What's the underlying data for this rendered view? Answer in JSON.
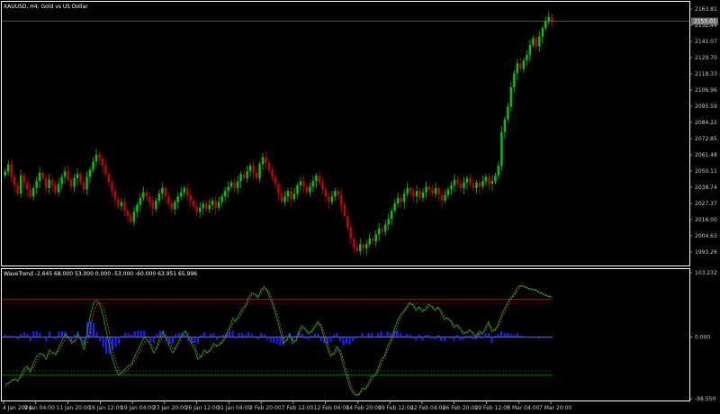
{
  "symbol_header": "XAUUSD, H4:  Gold vs US Dollar",
  "indicator_header": "WaveTrend -2.645 68.000 53.000 0.000 -53.000 -60.000 63.951 65.996",
  "current_price": "2155.01",
  "colors": {
    "background": "#000000",
    "bull_candle": "#00c800",
    "bear_candle": "#c80000",
    "axis": "#ffffff",
    "price_line": "#808080",
    "upper_band": "#c80000",
    "lower_band": "#00a000",
    "zero_line": "#a0a0ff",
    "histogram": "#2020ff",
    "wt1_line": "#00c000",
    "wt2_line": "#ff4040"
  },
  "price_axis": {
    "ticks": [
      "2163.81",
      "2152.44",
      "2141.07",
      "2129.70",
      "2118.33",
      "2106.96",
      "2095.59",
      "2084.22",
      "2072.85",
      "2061.48",
      "2050.11",
      "2038.74",
      "2027.37",
      "2016.00",
      "2004.63",
      "1993.26"
    ]
  },
  "indicator_axis": {
    "ticks": [
      "103.232",
      "0.000",
      "-98.550"
    ]
  },
  "time_axis": {
    "labels": [
      "4 Jan 2024",
      "9 Jan 04:00",
      "11 Jan 20:00",
      "16 Jan 12:00",
      "19 Jan 04:00",
      "23 Jan 20:00",
      "26 Jan 12:00",
      "31 Jan 04:00",
      "2 Feb 20:00",
      "7 Feb 12:00",
      "12 Feb 04:00",
      "14 Feb 20:00",
      "19 Feb 12:00",
      "22 Feb 04:00",
      "26 Feb 20:00",
      "29 Feb 12:00",
      "5 Mar 04:00",
      "7 Mar 20:00"
    ]
  },
  "chart_data": {
    "type": "candlestick",
    "price_range": [
      1984.0,
      2165.0
    ],
    "closes": [
      2048,
      2053,
      2044,
      2038,
      2032,
      2045,
      2040,
      2035,
      2030,
      2036,
      2041,
      2047,
      2043,
      2036,
      2042,
      2038,
      2033,
      2039,
      2044,
      2048,
      2042,
      2037,
      2043,
      2046,
      2040,
      2035,
      2044,
      2049,
      2055,
      2060,
      2057,
      2052,
      2046,
      2040,
      2034,
      2028,
      2023,
      2026,
      2020,
      2016,
      2012,
      2019,
      2024,
      2029,
      2033,
      2030,
      2026,
      2021,
      2027,
      2032,
      2036,
      2030,
      2025,
      2021,
      2026,
      2030,
      2033,
      2036,
      2031,
      2027,
      2023,
      2019,
      2022,
      2025,
      2021,
      2024,
      2027,
      2022,
      2026,
      2030,
      2034,
      2037,
      2040,
      2036,
      2041,
      2046,
      2043,
      2048,
      2052,
      2047,
      2043,
      2053,
      2058,
      2054,
      2049,
      2044,
      2039,
      2032,
      2026,
      2030,
      2034,
      2028,
      2032,
      2038,
      2041,
      2037,
      2033,
      2037,
      2041,
      2045,
      2040,
      2035,
      2030,
      2026,
      2030,
      2034,
      2031,
      2024,
      2016,
      2008,
      2000,
      1994,
      1991,
      1996,
      1993,
      1996,
      2000,
      1998,
      2003,
      2007,
      2005,
      2010,
      2014,
      2020,
      2025,
      2029,
      2026,
      2032,
      2036,
      2033,
      2030,
      2034,
      2029,
      2033,
      2037,
      2035,
      2032,
      2036,
      2031,
      2027,
      2031,
      2035,
      2038,
      2042,
      2039,
      2036,
      2040,
      2043,
      2039,
      2036,
      2040,
      2037,
      2041,
      2044,
      2039,
      2041,
      2045,
      2052,
      2076,
      2085,
      2094,
      2108,
      2118,
      2125,
      2121,
      2127,
      2131,
      2138,
      2143,
      2137,
      2144,
      2150,
      2155,
      2158,
      2155
    ],
    "wavetrend": {
      "upper_level": 53,
      "upper_level_2": 60,
      "lower_level": -53,
      "lower_level_2": -60,
      "range": [
        -98.55,
        103.232
      ],
      "wt1": [
        -75,
        -72,
        -68,
        -66,
        -70,
        -60,
        -50,
        -46,
        -55,
        -40,
        -30,
        -25,
        -28,
        -35,
        -20,
        -25,
        -28,
        -15,
        -5,
        5,
        0,
        -10,
        -5,
        5,
        -5,
        -20,
        10,
        35,
        55,
        58,
        50,
        35,
        10,
        -15,
        -35,
        -50,
        -60,
        -55,
        -50,
        -45,
        -42,
        -30,
        -20,
        -10,
        0,
        -5,
        -12,
        -25,
        -15,
        0,
        10,
        -2,
        -15,
        -25,
        -15,
        -5,
        5,
        10,
        0,
        -10,
        -20,
        -35,
        -30,
        -20,
        -25,
        -18,
        -10,
        -15,
        -10,
        -5,
        5,
        15,
        30,
        25,
        35,
        45,
        50,
        62,
        70,
        68,
        62,
        75,
        80,
        72,
        60,
        45,
        30,
        10,
        -10,
        -5,
        5,
        -10,
        -5,
        10,
        18,
        12,
        5,
        10,
        18,
        25,
        15,
        -2,
        -18,
        -30,
        -25,
        -15,
        -25,
        -45,
        -60,
        -78,
        -88,
        -92,
        -90,
        -80,
        -82,
        -72,
        -62,
        -60,
        -50,
        -35,
        -30,
        -15,
        -5,
        10,
        25,
        35,
        40,
        48,
        55,
        50,
        42,
        48,
        40,
        45,
        52,
        48,
        42,
        48,
        38,
        28,
        30,
        25,
        15,
        20,
        12,
        5,
        8,
        12,
        5,
        0,
        10,
        5,
        15,
        25,
        8,
        12,
        20,
        35,
        45,
        55,
        62,
        68,
        78,
        82,
        80,
        78,
        76,
        75,
        74,
        70,
        68,
        66,
        64,
        63
      ],
      "wt2": [
        -78,
        -74,
        -70,
        -67,
        -67,
        -64,
        -56,
        -50,
        -50,
        -47,
        -37,
        -30,
        -27,
        -30,
        -27,
        -24,
        -25,
        -22,
        -12,
        -2,
        0,
        -5,
        -8,
        -2,
        -2,
        -10,
        -8,
        15,
        38,
        52,
        55,
        47,
        30,
        5,
        -20,
        -38,
        -52,
        -57,
        -55,
        -50,
        -45,
        -37,
        -28,
        -18,
        -8,
        -5,
        -7,
        -18,
        -19,
        -8,
        3,
        3,
        -7,
        -17,
        -19,
        -10,
        0,
        7,
        5,
        -3,
        -13,
        -27,
        -32,
        -26,
        -24,
        -22,
        -15,
        -12,
        -12,
        -8,
        0,
        9,
        22,
        27,
        30,
        40,
        47,
        56,
        66,
        68,
        65,
        70,
        77,
        75,
        66,
        52,
        38,
        20,
        0,
        -7,
        0,
        -5,
        -7,
        4,
        14,
        14,
        8,
        8,
        14,
        21,
        20,
        5,
        -10,
        -24,
        -28,
        -20,
        -20,
        -35,
        -52,
        -69,
        -83,
        -90,
        -91,
        -85,
        -81,
        -77,
        -67,
        -61,
        -55,
        -42,
        -32,
        -22,
        -10,
        2,
        17,
        30,
        38,
        44,
        52,
        52,
        46,
        45,
        44,
        42,
        49,
        50,
        45,
        45,
        43,
        33,
        29,
        27,
        20,
        17,
        16,
        8,
        6,
        10,
        8,
        3,
        5,
        7,
        10,
        20,
        15,
        10,
        16,
        28,
        40,
        50,
        58,
        65,
        73,
        80,
        81,
        79,
        77,
        76,
        75,
        72,
        69,
        67,
        65,
        64
      ]
    }
  }
}
